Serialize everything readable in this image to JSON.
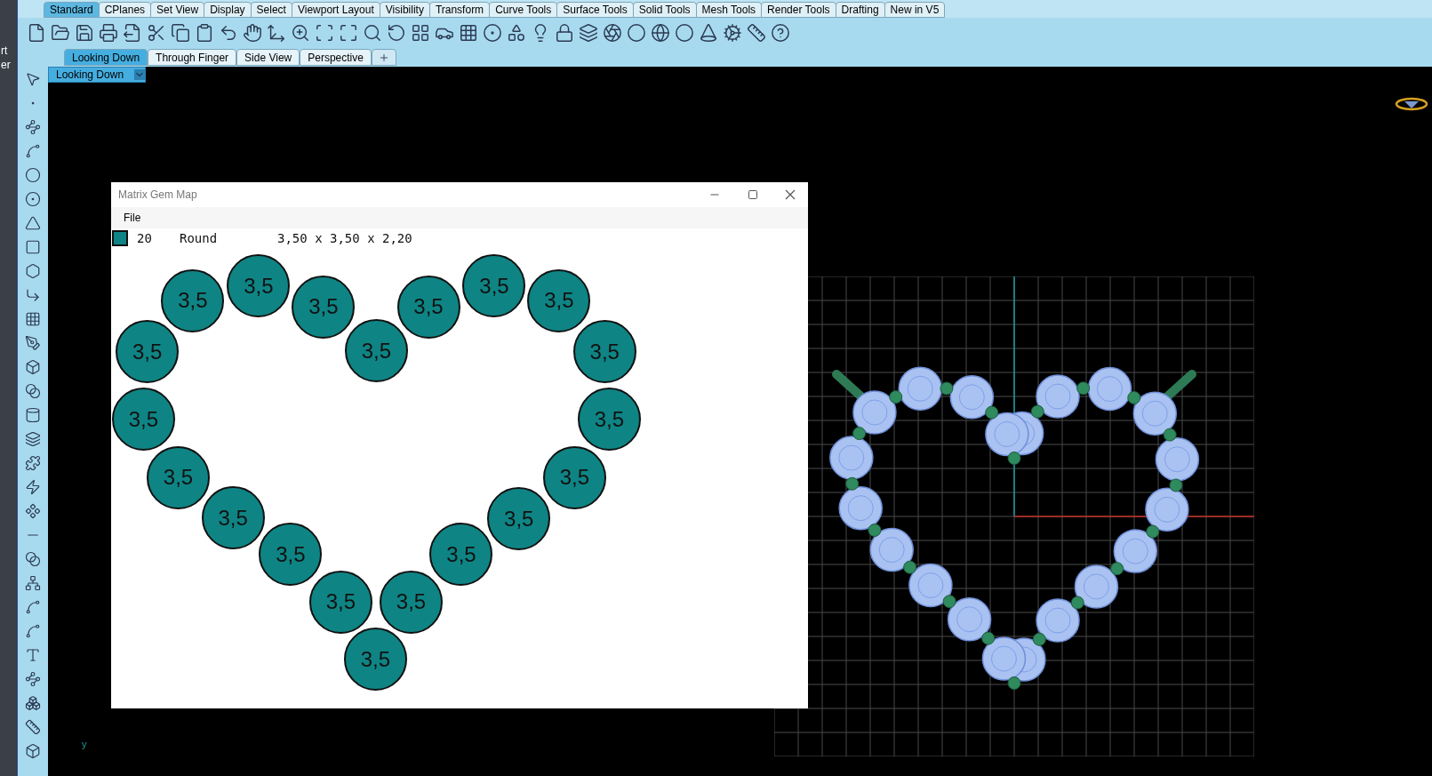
{
  "toolbar_tabs": [
    {
      "label": "Standard",
      "selected": true
    },
    {
      "label": "CPlanes",
      "selected": false
    },
    {
      "label": "Set View",
      "selected": false
    },
    {
      "label": "Display",
      "selected": false
    },
    {
      "label": "Select",
      "selected": false
    },
    {
      "label": "Viewport Layout",
      "selected": false
    },
    {
      "label": "Visibility",
      "selected": false
    },
    {
      "label": "Transform",
      "selected": false
    },
    {
      "label": "Curve Tools",
      "selected": false
    },
    {
      "label": "Surface Tools",
      "selected": false
    },
    {
      "label": "Solid Tools",
      "selected": false
    },
    {
      "label": "Mesh Tools",
      "selected": false
    },
    {
      "label": "Render Tools",
      "selected": false
    },
    {
      "label": "Drafting",
      "selected": false
    },
    {
      "label": "New in V5",
      "selected": false
    }
  ],
  "side_panel_fragments": [
    "rt",
    "er"
  ],
  "viewport_tabs": [
    {
      "label": "Looking Down",
      "selected": true
    },
    {
      "label": "Through Finger",
      "selected": false
    },
    {
      "label": "Side View",
      "selected": false
    },
    {
      "label": "Perspective",
      "selected": false
    }
  ],
  "viewport_label": "Looking Down",
  "axis_label": "y",
  "gem_window": {
    "title": "Matrix Gem Map",
    "menu": [
      "File"
    ],
    "summary": {
      "color": "#0f8484",
      "count": "20",
      "shape": "Round",
      "size": "3,50 x 3,50 x 2,20"
    },
    "gems": [
      {
        "label": "3,5"
      },
      {
        "label": "3,5"
      },
      {
        "label": "3,5"
      },
      {
        "label": "3,5"
      },
      {
        "label": "3,5"
      },
      {
        "label": "3,5"
      },
      {
        "label": "3,5"
      },
      {
        "label": "3,5"
      },
      {
        "label": "3,5"
      },
      {
        "label": "3,5"
      },
      {
        "label": "3,5"
      },
      {
        "label": "3,5"
      },
      {
        "label": "3,5"
      },
      {
        "label": "3,5"
      },
      {
        "label": "3,5"
      },
      {
        "label": "3,5"
      },
      {
        "label": "3,5"
      },
      {
        "label": "3,5"
      },
      {
        "label": "3,5"
      },
      {
        "label": "3,5"
      }
    ]
  }
}
